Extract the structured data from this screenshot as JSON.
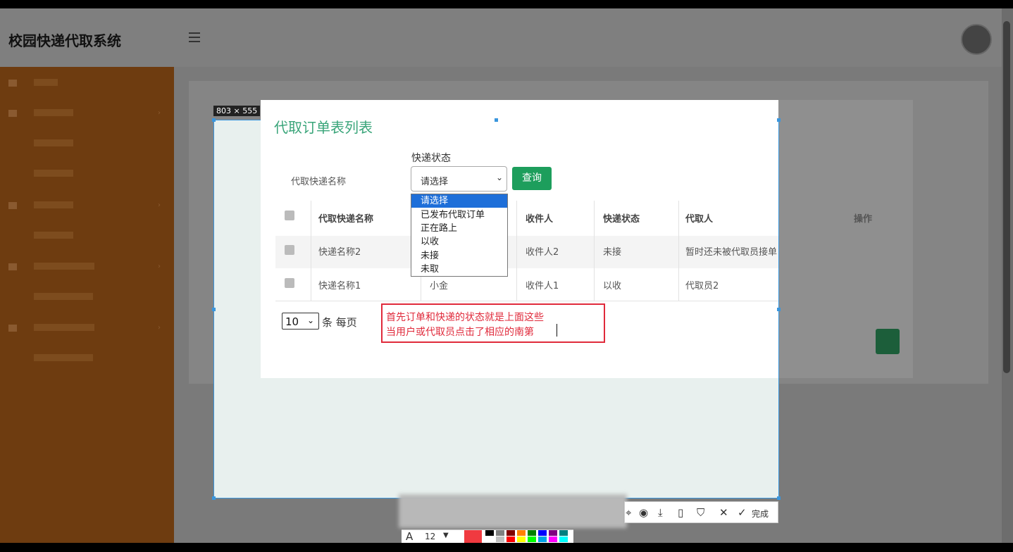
{
  "app": {
    "title": "校园快递代取系统"
  },
  "capture": {
    "size_label": "803 × 555"
  },
  "page": {
    "list_title": "代取订单表列表",
    "filter_name_label": "代取快递名称",
    "filter_status_label": "快递状态",
    "status_select_value": "请选择",
    "search_button": "查询"
  },
  "dropdown": {
    "options": [
      "请选择",
      "已发布代取订单",
      "正在路上",
      "以收",
      "未接",
      "未取"
    ],
    "selected_index": 0
  },
  "table": {
    "headers": [
      "代取快递名称",
      "收件人",
      "快递状态",
      "代取人",
      "操作"
    ],
    "rows": [
      {
        "name": "快递名称2",
        "owner": "",
        "recipient": "收件人2",
        "status": "未接",
        "agent": "暂时还未被代取员接单"
      },
      {
        "name": "快递名称1",
        "owner": "小金",
        "recipient": "收件人1",
        "status": "以收",
        "agent": "代取员2"
      }
    ]
  },
  "pager": {
    "page_size": "10",
    "label": "条 每页"
  },
  "annotation": {
    "line1": "首先订单和快递的状态就是上面这些",
    "line2": "当用户或代取员点击了相应的南第"
  },
  "toolbar": {
    "done_label": "完成",
    "font_size": "12",
    "current_color": "#f03a40",
    "swatches": [
      "#000000",
      "#808080",
      "#800000",
      "#ff8000",
      "#008000",
      "#0000ff",
      "#800080",
      "#008080",
      "#ffffff",
      "#c0c0c0",
      "#ff0000",
      "#ffff00",
      "#00ff00",
      "#00a2e8",
      "#ff00ff",
      "#00ffff"
    ]
  }
}
